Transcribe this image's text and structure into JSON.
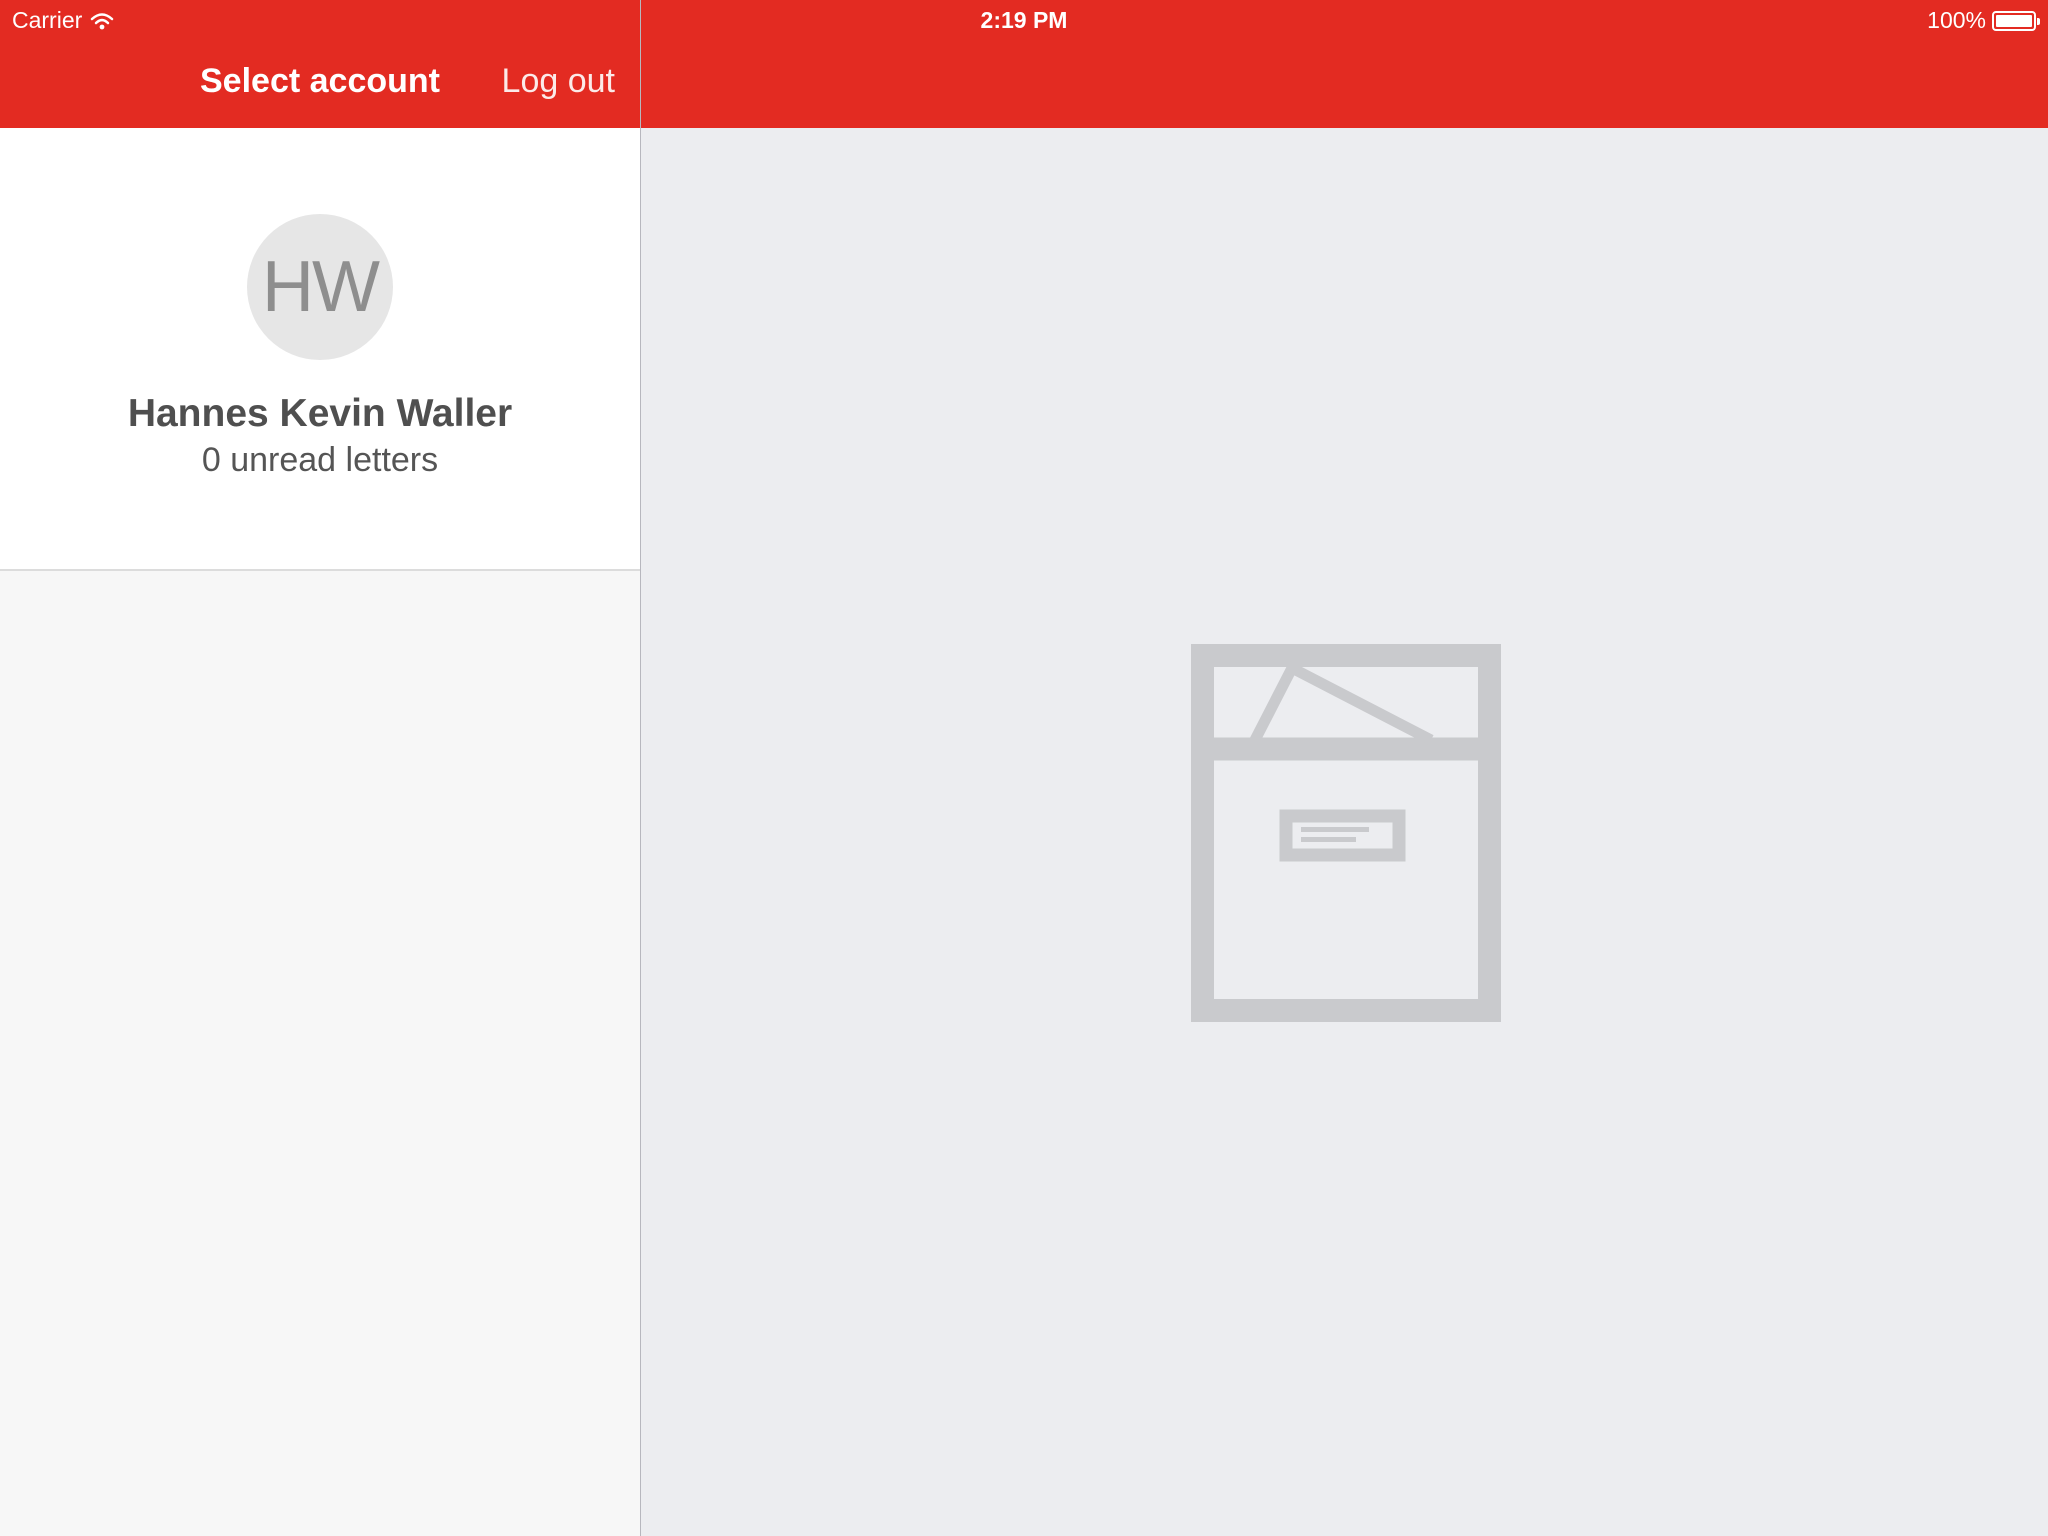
{
  "status_bar": {
    "carrier": "Carrier",
    "time": "2:19 PM",
    "battery": "100%",
    "battery_level": 1.0
  },
  "nav": {
    "title": "Select account",
    "logout_label": "Log out"
  },
  "accounts": [
    {
      "initials": "HW",
      "name": "Hannes Kevin Waller",
      "unread": "0 unread letters"
    }
  ],
  "colors": {
    "header": "#e32b22",
    "right_background": "#ecedf0",
    "left_background": "#f7f7f7",
    "placeholder_icon": "#c9cacd"
  },
  "detail": {
    "placeholder_icon": "mailbox-icon"
  }
}
